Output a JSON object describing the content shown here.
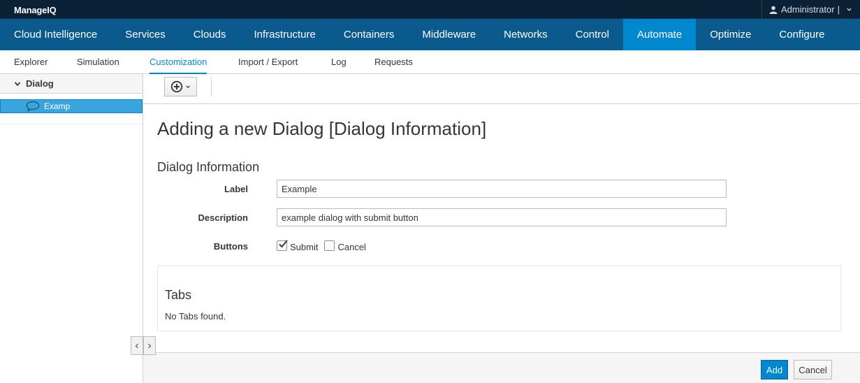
{
  "brand": {
    "bold": "Manage",
    "rest": "IQ"
  },
  "user": {
    "name": "Administrator",
    "separator": "|"
  },
  "main_nav": {
    "items": [
      {
        "label": "Cloud Intelligence",
        "active": false
      },
      {
        "label": "Services",
        "active": false
      },
      {
        "label": "Clouds",
        "active": false
      },
      {
        "label": "Infrastructure",
        "active": false
      },
      {
        "label": "Containers",
        "active": false
      },
      {
        "label": "Middleware",
        "active": false
      },
      {
        "label": "Networks",
        "active": false
      },
      {
        "label": "Control",
        "active": false
      },
      {
        "label": "Automate",
        "active": true
      },
      {
        "label": "Optimize",
        "active": false
      },
      {
        "label": "Configure",
        "active": false
      }
    ]
  },
  "sub_nav": {
    "items": [
      {
        "label": "Explorer",
        "active": false
      },
      {
        "label": "Simulation",
        "active": false
      },
      {
        "label": "Customization",
        "active": true
      },
      {
        "label": "Import / Export",
        "active": false
      },
      {
        "label": "Log",
        "active": false
      },
      {
        "label": "Requests",
        "active": false
      }
    ]
  },
  "sidebar": {
    "accordion_title": "Dialog",
    "tree_items": [
      {
        "label": "Examp",
        "selected": true
      }
    ]
  },
  "page": {
    "title": "Adding a new Dialog [Dialog Information]",
    "section_title": "Dialog Information"
  },
  "form": {
    "label_field": {
      "label": "Label",
      "value": "Example"
    },
    "description_field": {
      "label": "Description",
      "value": "example dialog with submit button"
    },
    "buttons_field": {
      "label": "Buttons",
      "options": [
        {
          "label": "Submit",
          "checked": true
        },
        {
          "label": "Cancel",
          "checked": false
        }
      ]
    }
  },
  "tabs": {
    "title": "Tabs",
    "empty_text": "No Tabs found."
  },
  "footer": {
    "add_label": "Add",
    "cancel_label": "Cancel"
  },
  "colors": {
    "brand_bar": "#0b2236",
    "nav_bar": "#0a5a8e",
    "nav_active": "#0088ce",
    "tree_selected": "#39a5dc",
    "primary_button": "#0088ce"
  }
}
